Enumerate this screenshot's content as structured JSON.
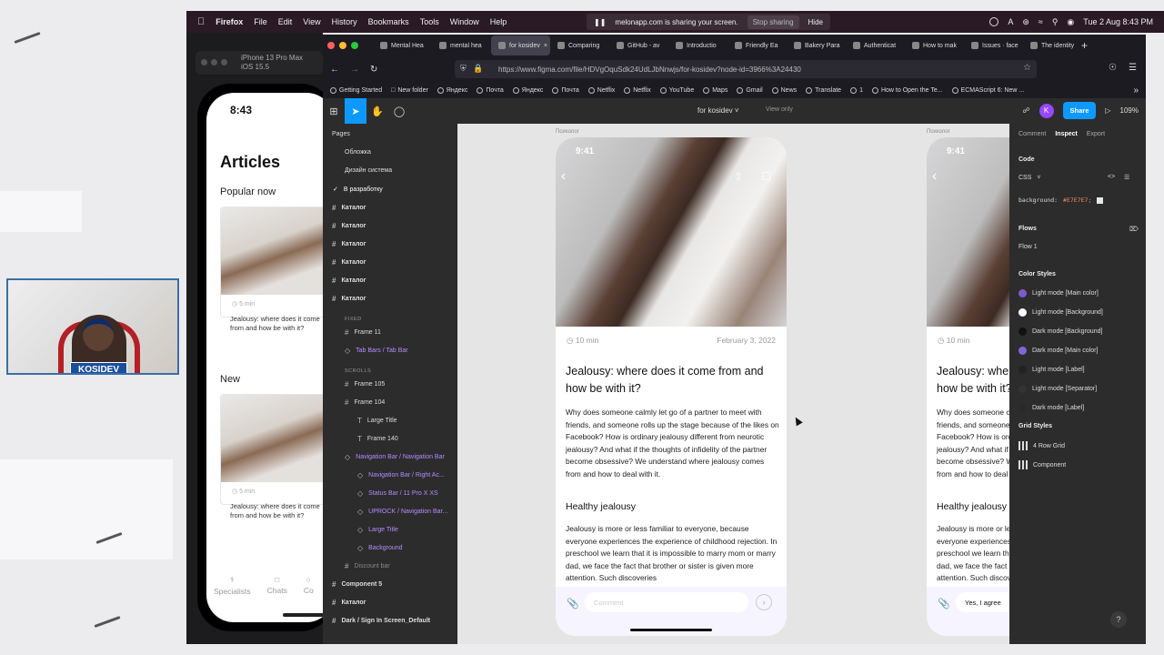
{
  "menubar": {
    "app": "Firefox",
    "items": [
      "File",
      "Edit",
      "View",
      "History",
      "Bookmarks",
      "Tools",
      "Window",
      "Help"
    ],
    "sharing_text": "melonapp.com is sharing your screen.",
    "stop_label": "Stop sharing",
    "hide_label": "Hide",
    "datetime": "Tue 2 Aug  8:43 PM"
  },
  "simulator": {
    "title": "iPhone 13 Pro Max",
    "subtitle": "iOS 15.5"
  },
  "phone": {
    "time": "8:43",
    "title": "Articles",
    "popular": "Popular now",
    "new": "New",
    "card_meta": "5 min",
    "card_text": "Jealousy: where does it come from and how be with it?",
    "tabs": [
      "Specialists",
      "Chats",
      "Co"
    ]
  },
  "webcam": {
    "label": "KOSIDEV"
  },
  "browser": {
    "tabs": [
      "Mental Hea",
      "mental hea",
      "for kosidev",
      "Comparing",
      "GitHub - av",
      "Introductio",
      "Friendly Ea",
      "Bakery Para",
      "Authenticat",
      "How to mak",
      "Issues · face",
      "The identity"
    ],
    "url": "https://www.figma.com/file/HDVgOquSdk24UdLJbNnwjs/for-kosidev?node-id=3966%3A24430",
    "bookmarks": [
      "Getting Started",
      "New folder",
      "Яндекс",
      "Почта",
      "Яндекс",
      "Почта",
      "Netflix",
      "Netflix",
      "YouTube",
      "Maps",
      "Gmail",
      "News",
      "Translate",
      "1",
      "How to Open the Te...",
      "ECMAScript 6: New ..."
    ]
  },
  "figma": {
    "file_name": "for kosidev",
    "view_only": "View only",
    "avatar": "K",
    "share": "Share",
    "zoom": "109%",
    "pages_label": "Pages",
    "pages": [
      "Обложка",
      "Дизайн система",
      "В разработку"
    ],
    "layers": [
      {
        "label": "Каталог",
        "kind": "frame"
      },
      {
        "label": "Каталог",
        "kind": "frame"
      },
      {
        "label": "Каталог",
        "kind": "frame"
      },
      {
        "label": "Каталог",
        "kind": "frame"
      },
      {
        "label": "Каталог",
        "kind": "frame"
      },
      {
        "label": "Каталог",
        "kind": "frame"
      },
      {
        "label": "FIXED",
        "kind": "section"
      },
      {
        "label": "Frame 11",
        "kind": "child"
      },
      {
        "label": "Tab Bars / Tab Bar",
        "kind": "component"
      },
      {
        "label": "SCROLLS",
        "kind": "section"
      },
      {
        "label": "Frame 105",
        "kind": "child"
      },
      {
        "label": "Frame 104",
        "kind": "child"
      },
      {
        "label": "Large Title",
        "kind": "child2"
      },
      {
        "label": "Frame 140",
        "kind": "child2"
      },
      {
        "label": "Navigation Bar / Navigation Bar",
        "kind": "component"
      },
      {
        "label": "Navigation Bar / Right Ac...",
        "kind": "component2"
      },
      {
        "label": "Status Bar / 11 Pro X XS",
        "kind": "component2"
      },
      {
        "label": "UPROCK / Navigation Bar...",
        "kind": "component2"
      },
      {
        "label": "Large Title",
        "kind": "component2"
      },
      {
        "label": "Background",
        "kind": "component2"
      },
      {
        "label": "Discount bar",
        "kind": "dim"
      },
      {
        "label": "Component 5",
        "kind": "frame"
      },
      {
        "label": "Каталог",
        "kind": "frame"
      },
      {
        "label": "Dark / Sign In Screen_Default",
        "kind": "frame"
      }
    ],
    "frame_label": "Психолог",
    "article": {
      "time": "9:41",
      "minutes": "10 min",
      "date": "February 3, 2022",
      "heading": "Jealousy: where does it come from and how be with it?",
      "body": "Why does someone calmly let go of a partner to meet with friends, and someone rolls up the stage because of the likes on Facebook? How is ordinary jealousy different from neurotic jealousy? And what if the thoughts of infidelity of the partner become obsessive? We understand where jealousy comes from and how to deal with it.",
      "subheading": "Healthy jealousy",
      "body2": "Jealousy is more or less familiar to everyone, because everyone experiences the experience of childhood rejection. In preschool we learn that it is impossible to marry mom or marry dad, we face the fact that brother or sister is given more attention. Such discoveries",
      "comment_placeholder": "Comment",
      "comment_value": "Yes, I agree"
    },
    "inspect": {
      "tabs": [
        "Comment",
        "Inspect",
        "Export"
      ],
      "code_label": "Code",
      "lang": "CSS",
      "css_prop": "background:",
      "css_value": "#E7E7E7;",
      "flows_label": "Flows",
      "flow": "Flow 1",
      "color_styles_label": "Color Styles",
      "colors": [
        {
          "name": "Light mode [Main color]",
          "color": "#7b5ccf"
        },
        {
          "name": "Light mode [Background]",
          "color": "#ffffff"
        },
        {
          "name": "Dark mode [Background]",
          "color": "#111111"
        },
        {
          "name": "Dark mode [Main color]",
          "color": "#8466d8"
        },
        {
          "name": "Light mode [Label]",
          "color": "#222222"
        },
        {
          "name": "Light mode [Separator]",
          "color": "#333333"
        },
        {
          "name": "Dark mode [Label]",
          "color": "#2a2a2a"
        }
      ],
      "grid_styles_label": "Grid Styles",
      "grids": [
        "4 Row Grid",
        "Component"
      ]
    }
  }
}
